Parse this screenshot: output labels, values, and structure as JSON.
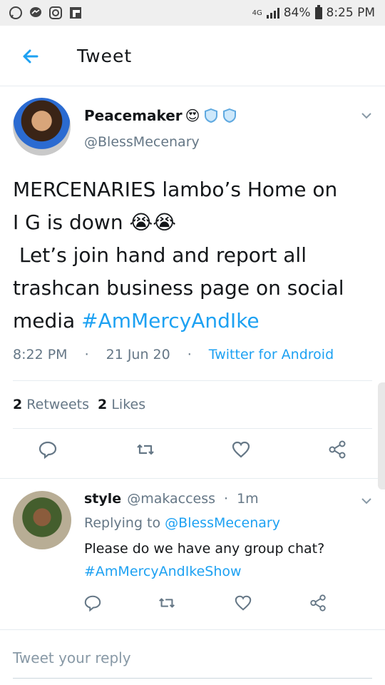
{
  "status_bar": {
    "network": "4G",
    "battery": "84%",
    "time": "8:25 PM"
  },
  "header": {
    "title": "Tweet"
  },
  "tweet": {
    "display_name": "Peacemaker",
    "emoji": "😍",
    "handle": "@BlessMecenary",
    "lines": [
      "MERCENARIES lambo’s Home on",
      "I G is down 😭😭",
      " Let’s join hand and report all",
      "trashcan business page on social",
      "media "
    ],
    "hashtag": "#AmMercyAndIke",
    "time": "8:22 PM",
    "date": "21 Jun 20",
    "source": "Twitter for Android",
    "retweets_count": "2",
    "retweets_label": "Retweets",
    "likes_count": "2",
    "likes_label": "Likes"
  },
  "reply": {
    "display_name": "style",
    "handle": "@makaccess",
    "age": "1m",
    "replying_label": "Replying to",
    "replying_handle": "@BlessMecenary",
    "text": "Please do we have any group chat?",
    "hashtag": "#AmMercyAndIkeShow"
  },
  "composer": {
    "placeholder": "Tweet your reply"
  },
  "colors": {
    "accent": "#1da1f2",
    "secondary_text": "#657786",
    "divider": "#e6ecf0"
  }
}
